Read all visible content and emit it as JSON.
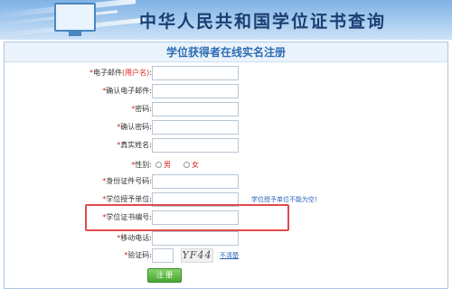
{
  "header": {
    "title": "中华人民共和国学位证书查询",
    "icon": "monitor-icon"
  },
  "form": {
    "title": "学位获得者在线实名注册",
    "rows": [
      {
        "star": "*",
        "label": "电子邮件",
        "hint": "(用户名)",
        "suffix": ":"
      },
      {
        "star": "*",
        "label": "确认电子邮件:"
      },
      {
        "star": "*",
        "label": "密码:"
      },
      {
        "star": "*",
        "label": "确认密码:"
      },
      {
        "star": "*",
        "label": "真实姓名:"
      },
      {
        "star": "*",
        "label": "性别:"
      },
      {
        "star": "*",
        "label": "身份证件号码:"
      },
      {
        "star": "*",
        "label": "学位授予单位:"
      },
      {
        "star": "*",
        "label": "学位证书编号:"
      },
      {
        "star": "*",
        "label": "移动电话:"
      },
      {
        "star": "*",
        "label": "验证码:"
      }
    ],
    "gender_options": [
      "男",
      "女"
    ],
    "help_link": "学位授予单位不能为空!",
    "captcha_text": "YF44",
    "refresh_link": "不清楚",
    "submit_label": "注 册"
  },
  "colors": {
    "accent_red": "#d9241b",
    "link_blue": "#2a62b8",
    "highlight": "#e04b4b",
    "submit_green": "#4aa532"
  }
}
